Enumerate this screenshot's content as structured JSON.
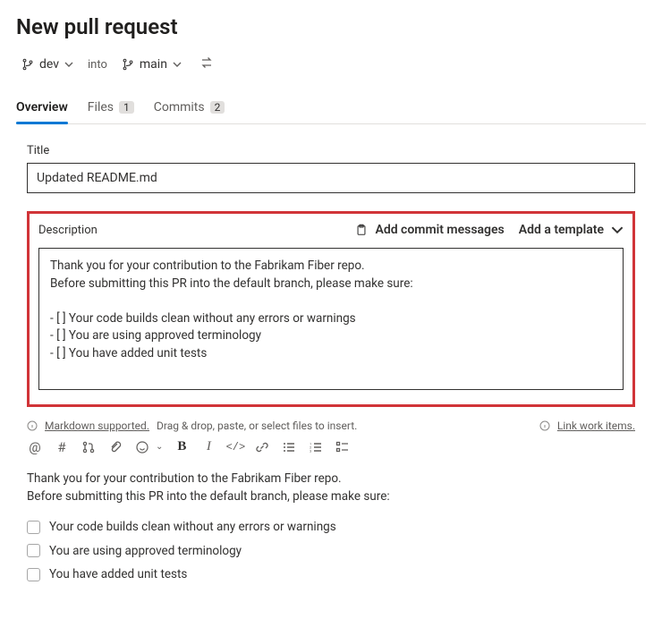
{
  "header": {
    "title": "New pull request"
  },
  "branches": {
    "source": "dev",
    "into_label": "into",
    "target": "main"
  },
  "tabs": {
    "overview": "Overview",
    "files": "Files",
    "files_count": "1",
    "commits": "Commits",
    "commits_count": "2"
  },
  "title_field": {
    "label": "Title",
    "value": "Updated README.md"
  },
  "description": {
    "label": "Description",
    "add_commit_msgs": "Add commit messages",
    "add_template": "Add a template",
    "text": "Thank you for your contribution to the Fabrikam Fiber repo.\nBefore submitting this PR into the default branch, please make sure:\n\n- [ ] Your code builds clean without any errors or warnings\n- [ ] You are using approved terminology\n- [ ] You have added unit tests"
  },
  "hints": {
    "markdown": "Markdown supported.",
    "drop": "Drag & drop, paste, or select files to insert.",
    "link_items": "Link work items."
  },
  "preview": {
    "intro_line1": "Thank you for your contribution to the Fabrikam Fiber repo.",
    "intro_line2": "Before submitting this PR into the default branch, please make sure:",
    "items": [
      "Your code builds clean without any errors or warnings",
      "You are using approved terminology",
      "You have added unit tests"
    ]
  }
}
